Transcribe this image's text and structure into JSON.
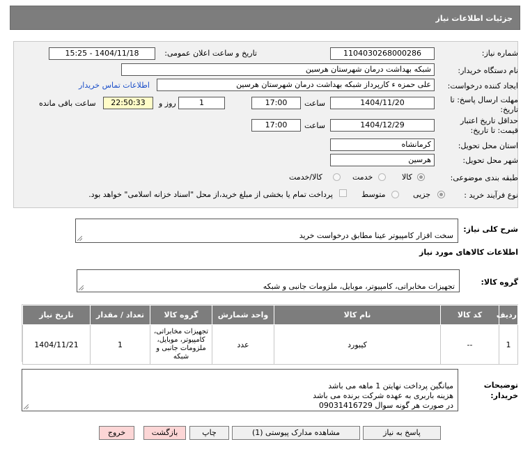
{
  "header": {
    "title": "جزئیات اطلاعات نیاز"
  },
  "form": {
    "need_number_label": "شماره نیاز:",
    "need_number": "1104030268000286",
    "announce_label": "تاریخ و ساعت اعلان عمومی:",
    "announce_value": "1404/11/18 - 15:25",
    "buyer_org_label": "نام دستگاه خریدار:",
    "buyer_org": "شبکه بهداشت درمان شهرستان هرسین",
    "requester_label": "ایجاد کننده درخواست:",
    "requester": "علی حمزه ء کارپرداز شبکه بهداشت درمان شهرستان هرسین",
    "contact_link": "اطلاعات تماس خریدار",
    "deadline_label": "مهلت ارسال پاسخ: تا تاریخ:",
    "deadline_date": "1404/11/20",
    "time_label": "ساعت",
    "deadline_time": "17:00",
    "days_value": "1",
    "days_label": "روز و",
    "remaining_time": "22:50:33",
    "remaining_label": "ساعت باقی مانده",
    "validity_label": "حداقل تاریخ اعتبار قیمت: تا تاریخ:",
    "validity_date": "1404/12/29",
    "validity_time": "17:00",
    "province_label": "استان محل تحویل:",
    "province": "کرمانشاه",
    "city_label": "شهر محل تحویل:",
    "city": "هرسین",
    "category_label": "طبقه بندی موضوعی:",
    "category_options": [
      "کالا",
      "خدمت",
      "کالا/خدمت"
    ],
    "purchase_type_label": "نوع فرآیند خرید :",
    "purchase_options": [
      "جزیی",
      "متوسط"
    ],
    "payment_note": "پرداخت تمام یا بخشی از مبلغ خرید،از محل \"اسناد خزانه اسلامی\" خواهد بود."
  },
  "description": {
    "label": "شرح کلی نیاز:",
    "value": "سخت افزار کامپیوتر عینا مطابق درخواست خرید"
  },
  "goods_info_title": "اطلاعات کالاهای مورد نیاز",
  "goods_group": {
    "label": "گروه کالا:",
    "value": "تجهیزات مخابراتی، کامپیوتر، موبایل، ملزومات جانبی و شبکه"
  },
  "table": {
    "headers": [
      "ردیف",
      "کد کالا",
      "نام کالا",
      "واحد شمارش",
      "گروه کالا",
      "تعداد / مقدار",
      "تاریخ نیاز"
    ],
    "rows": [
      {
        "row": "1",
        "code": "--",
        "name": "کیبورد",
        "unit": "عدد",
        "group": "تجهیزات مخابراتی، کامپیوتر، موبایل، ملزومات جانبی و شبکه",
        "qty": "1",
        "date": "1404/11/21"
      }
    ]
  },
  "buyer_notes": {
    "label": "توضیحات خریدار:",
    "value": "میانگین پرداخت نهایتن 1 ماهه می باشد\nهزینه باربری به عهده شرکت برنده می باشد\nدر صورت هر گونه سوال 09031416729"
  },
  "buttons": {
    "reply": "پاسخ به نیاز",
    "attachments": "مشاهده مدارک پیوستی (1)",
    "print": "چاپ",
    "back": "بازگشت",
    "exit": "خروج"
  }
}
